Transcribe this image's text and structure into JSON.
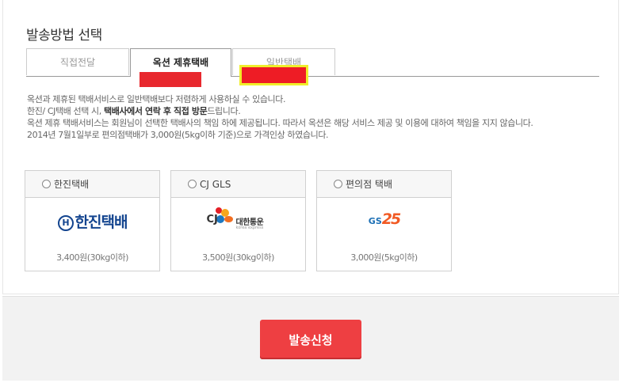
{
  "section": {
    "title": "발송방법 선택"
  },
  "tabs": [
    {
      "label": "직접전달",
      "active": false
    },
    {
      "label": "옥션 제휴택배",
      "active": true
    },
    {
      "label": "일반택배",
      "active": false
    }
  ],
  "description": {
    "line1": "옥션과 제휴된 택배서비스로 일반택배보다 저렴하게 사용하실 수 있습니다.",
    "line2_prefix": "한진/ CJ택배 선택 시,",
    "line2_bold": "택배사에서 연락 후 직접 방문",
    "line2_suffix": "드립니다.",
    "line3": "옥션 제휴 택배서비스는 회원님이 선택한 택배사의 책임 하에 제공됩니다. 따라서 옥션은 해당 서비스 제공 및 이용에 대하여 책임을 지지 않습니다.",
    "line4": "2014년 7월1일부로 편의점택배가 3,000원(5kg이하 기준)으로 가격인상 하였습니다."
  },
  "carriers": [
    {
      "name": "한진택배",
      "logo_text": "한진택배",
      "logo_mark": "H",
      "price": "3,400원(30kg이하)"
    },
    {
      "name": "CJ GLS",
      "logo_text": "CJ",
      "logo_name": "대한통운",
      "logo_sub": "korea express",
      "price": "3,500원(30kg이하)"
    },
    {
      "name": "편의점 택배",
      "logo_text": "GS",
      "logo_num": "25",
      "price": "3,000원(5kg이하)"
    }
  ],
  "footer": {
    "submit_label": "발송신청"
  },
  "colors": {
    "accent": "#ee3f42",
    "redaction": "#e8282e",
    "highlight": "#f0ee2a"
  }
}
